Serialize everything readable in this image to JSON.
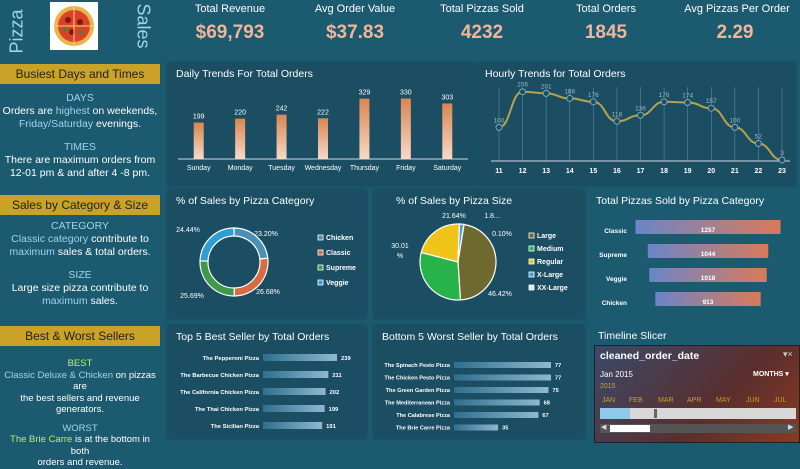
{
  "logo": {
    "left_text": "Pizza",
    "right_text": "Sales"
  },
  "kpis": [
    {
      "label": "Total Revenue",
      "value": "$69,793"
    },
    {
      "label": "Avg Order Value",
      "value": "$37.83"
    },
    {
      "label": "Total Pizzas Sold",
      "value": "4232"
    },
    {
      "label": "Total Orders",
      "value": "1845"
    },
    {
      "label": "Avg Pizzas Per Order",
      "value": "2.29"
    }
  ],
  "sidebar": {
    "busiest": {
      "title": "Busiest Days and Times",
      "days_head": "DAYS",
      "days_l1_a": "Orders are ",
      "days_l1_b": "highest",
      "days_l1_c": " on weekends,",
      "days_l2": "Friday/Saturday",
      "days_l2_b": " evenings.",
      "times_head": "TIMES",
      "times_l1": "There are maximum orders from",
      "times_l2": "12-01 pm & and after 4 -8 pm."
    },
    "category": {
      "title": "Sales by Category & Size",
      "cat_head": "CATEGORY",
      "cat_l1_a": "Classic category",
      "cat_l1_b": " contribute to",
      "cat_l2_a": "maximum",
      "cat_l2_b": " sales & total orders.",
      "size_head": "SIZE",
      "size_l1": "Large size pizza contribute to",
      "size_l2_a": "maximum",
      "size_l2_b": " sales."
    },
    "sellers": {
      "title": "Best & Worst Sellers",
      "best_head": "BEST",
      "best_l1_a": "Classic Deluxe & Chicken",
      "best_l1_b": " on pizzas are",
      "best_l2": "the best sellers and revenue generators.",
      "worst_head": "WORST",
      "worst_l1_a": "The Brie Carre",
      "worst_l1_b": " is at the bottom in both",
      "worst_l2": "orders and revenue."
    }
  },
  "panels": {
    "daily": "Daily Trends For Total Orders",
    "hourly": "Hourly Trends for Total Orders",
    "category": "% of Sales by Pizza Category",
    "size": "% of Sales by Pizza Size",
    "sold_by_cat": "Total Pizzas Sold by Pizza Category",
    "top5": "Top 5 Best Seller by Total Orders",
    "bottom5": "Bottom 5 Worst Seller by Total Orders",
    "timeline": "Timeline Slicer"
  },
  "timeline": {
    "field": "cleaned_order_date",
    "period": "Jan 2015",
    "level": "MONTHS",
    "year": "2015",
    "months": [
      "JAN",
      "FEB",
      "MAR",
      "APR",
      "MAY",
      "JUN",
      "JUL"
    ]
  },
  "chart_data": [
    {
      "type": "bar",
      "title": "Daily Trends For Total Orders",
      "categories": [
        "Sunday",
        "Monday",
        "Tuesday",
        "Wednesday",
        "Thursday",
        "Friday",
        "Saturday"
      ],
      "values": [
        199,
        220,
        242,
        222,
        329,
        330,
        303
      ]
    },
    {
      "type": "line",
      "title": "Hourly Trends for Total Orders",
      "categories": [
        "11",
        "12",
        "13",
        "14",
        "15",
        "16",
        "17",
        "18",
        "19",
        "20",
        "21",
        "22",
        "23"
      ],
      "values": [
        100,
        206,
        201,
        186,
        176,
        118,
        136,
        176,
        174,
        157,
        100,
        52,
        3
      ]
    },
    {
      "type": "pie",
      "title": "% of Sales by Pizza Category",
      "labels": [
        "Chicken",
        "Classic",
        "Supreme",
        "Veggie"
      ],
      "values": [
        23.2,
        26.68,
        25.69,
        24.44
      ],
      "value_labels": [
        "23.20%",
        "26.68%",
        "25.69%",
        "24.44%"
      ],
      "colors": [
        "#4a90b8",
        "#d96b43",
        "#3e9a49",
        "#2f9ed2"
      ]
    },
    {
      "type": "pie",
      "title": "% of Sales by Pizza Size",
      "labels": [
        "Large",
        "Medium",
        "Regular",
        "X-Large",
        "XX-Large"
      ],
      "values": [
        46.42,
        30.01,
        21.64,
        1.8,
        0.1
      ],
      "value_labels": [
        "46.42%",
        "30.01 %",
        "21.64%",
        "1.8...",
        "0.10%"
      ],
      "colors": [
        "#6e6a2f",
        "#27b24a",
        "#f0c419",
        "#3fa0d8",
        "#e8e8e8"
      ]
    },
    {
      "type": "bar",
      "title": "Total Pizzas Sold by Pizza Category",
      "orientation": "horizontal",
      "categories": [
        "Classic",
        "Supreme",
        "Veggie",
        "Chicken"
      ],
      "values": [
        1257,
        1044,
        1018,
        913
      ]
    },
    {
      "type": "bar",
      "title": "Top 5 Best Seller by Total Orders",
      "orientation": "horizontal",
      "categories": [
        "The Pepperoni Pizza",
        "The Barbecue Chicken Pizza",
        "The California Chicken Pizza",
        "The Thai Chicken Pizza",
        "The Sicilian Pizza"
      ],
      "values": [
        239,
        211,
        202,
        199,
        191
      ]
    },
    {
      "type": "bar",
      "title": "Bottom 5 Worst Seller by Total Orders",
      "orientation": "horizontal",
      "categories": [
        "The Spinach Pesto Pizza",
        "The Chicken Pesto Pizza",
        "The Green Garden Pizza",
        "The Mediterranean Pizza",
        "The Calabrese Pizza",
        "The Brie Carre Pizza"
      ],
      "values": [
        77,
        77,
        75,
        68,
        67,
        35
      ]
    }
  ]
}
